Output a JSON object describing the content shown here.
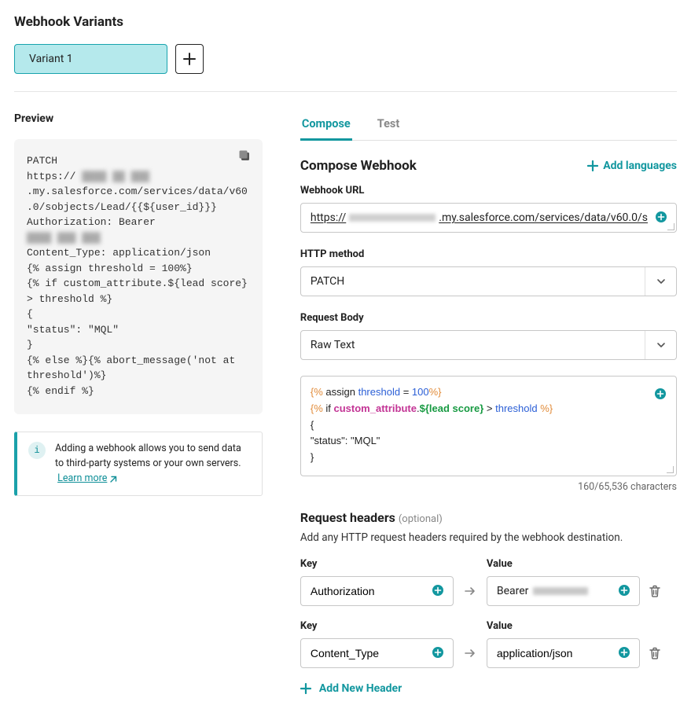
{
  "header": {
    "title": "Webhook Variants",
    "variant_tab": "Variant 1"
  },
  "preview": {
    "label": "Preview",
    "line1a": "PATCH",
    "line2a": "https://",
    "line2b": ".my.salesforce.com/services/data/v60.0/sobjects/Lead/{{${user_id}}}",
    "line3": "Authorization: Bearer",
    "line5": "Content_Type: application/json",
    "line6": "{% assign threshold = 100%}",
    "line7": "{% if custom_attribute.${lead score} > threshold %}",
    "line8": "{",
    "line9": "\"status\": \"MQL\"",
    "line10": "}",
    "line11": "{% else %}{% abort_message('not at threshold')%}",
    "line12": "{% endif %}"
  },
  "info": {
    "text": "Adding a webhook allows you to send data to third-party systems or your own servers.",
    "link": "Learn more"
  },
  "tabs": {
    "compose": "Compose",
    "test": "Test"
  },
  "compose": {
    "title": "Compose Webhook",
    "add_languages": "Add languages",
    "url_label": "Webhook URL",
    "url_prefix": "https://",
    "url_suffix": ".my.salesforce.com/services/data/v60.0/s",
    "method_label": "HTTP method",
    "method_value": "PATCH",
    "body_label": "Request Body",
    "body_type_value": "Raw Text",
    "body_counter": "160/65,536 characters",
    "headers_label": "Request headers",
    "headers_optional": "(optional)",
    "headers_subtext": "Add any HTTP request headers required by the webhook destination.",
    "key_label": "Key",
    "value_label": "Value",
    "headers": [
      {
        "key": "Authorization",
        "value": "Bearer "
      },
      {
        "key": "Content_Type",
        "value": "application/json"
      }
    ],
    "add_header": "Add New Header"
  },
  "body_tokens": {
    "l1_a": "{%",
    "l1_b": " assign ",
    "l1_c": "threshold",
    "l1_d": " = ",
    "l1_e": "100",
    "l1_f": "%}",
    "l2_a": "{%",
    "l2_b": " if ",
    "l2_c": "custom_attribute",
    "l2_d": ".",
    "l2_e": "${lead score}",
    "l2_f": " > ",
    "l2_g": "threshold ",
    "l2_h": "%}",
    "l3": "{",
    "l4": "\"status\": \"MQL\"",
    "l5": "}"
  }
}
